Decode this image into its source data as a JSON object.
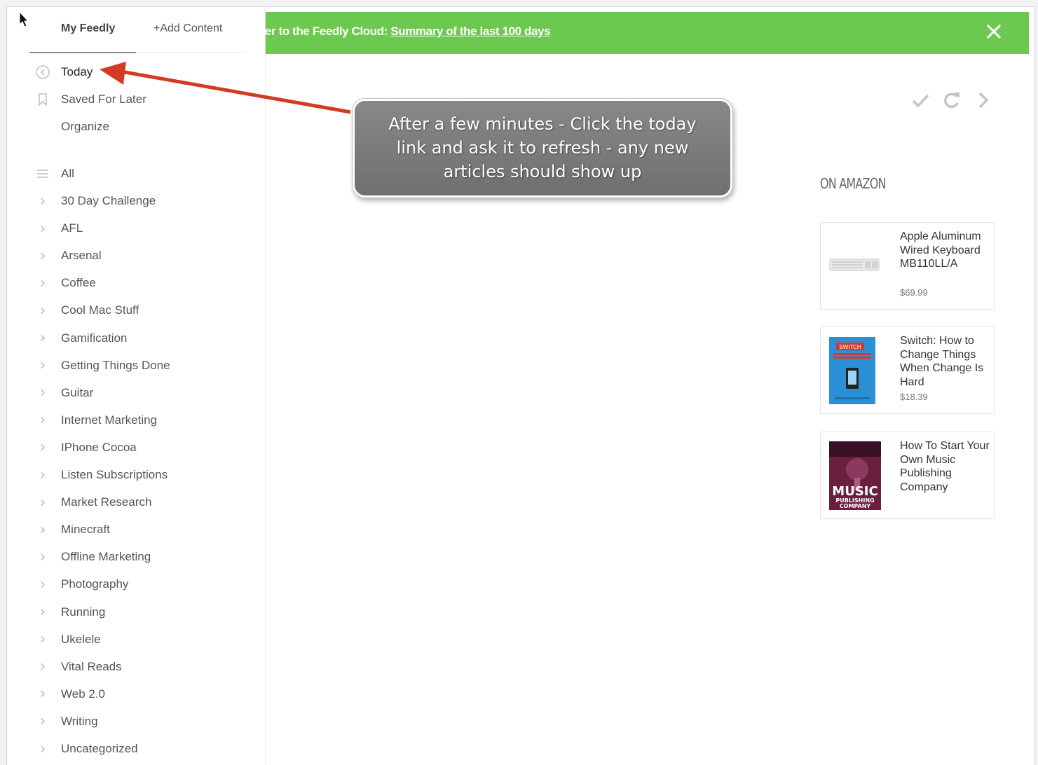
{
  "sidebar": {
    "tabs": {
      "my_feedly": "My Feedly",
      "add_content": "+Add Content"
    },
    "top_items": [
      {
        "label": "Today",
        "icon": "today-icon"
      },
      {
        "label": "Saved For Later",
        "icon": "bookmark-icon"
      },
      {
        "label": "Organize",
        "icon": ""
      }
    ],
    "all_label": "All",
    "categories": [
      "30 Day Challenge",
      "AFL",
      "Arsenal",
      "Coffee",
      "Cool Mac Stuff",
      "Gamification",
      "Getting Things Done",
      "Guitar",
      "Internet Marketing",
      "IPhone Cocoa",
      "Listen Subscriptions",
      "Market Research",
      "Minecraft",
      "Offline Marketing",
      "Photography",
      "Running",
      "Ukelele",
      "Vital Reads",
      "Web 2.0",
      "Writing",
      "Uncategorized"
    ]
  },
  "banner": {
    "text": "er to the Feedly Cloud: ",
    "link": "Summary of the last 100 days",
    "color": "#6cc94f"
  },
  "toolbar": {
    "icons": [
      "checkmark-icon",
      "refresh-icon",
      "chevron-right-icon"
    ]
  },
  "callout": {
    "lines": [
      "After a few minutes - Click the today",
      "link and ask it to refresh - any new",
      "articles should show up"
    ]
  },
  "amazon": {
    "heading": "ON AMAZON",
    "products": [
      {
        "title": "Apple Aluminum Wired Keyboard MB110LL/A",
        "price": "$69.99",
        "image": "keyboard-image"
      },
      {
        "title": "Switch: How to Change Things When Change Is Hard",
        "price": "$18.39",
        "image": "switch-book-cover"
      },
      {
        "title": "How To Start Your Own Music Publishing Company",
        "price": "",
        "image": "music-book-cover"
      }
    ],
    "book_cover_text": {
      "switch": "SWITCH",
      "music": "MUSIC",
      "publishing": "PUBLISHING",
      "company": "COMPANY"
    }
  }
}
